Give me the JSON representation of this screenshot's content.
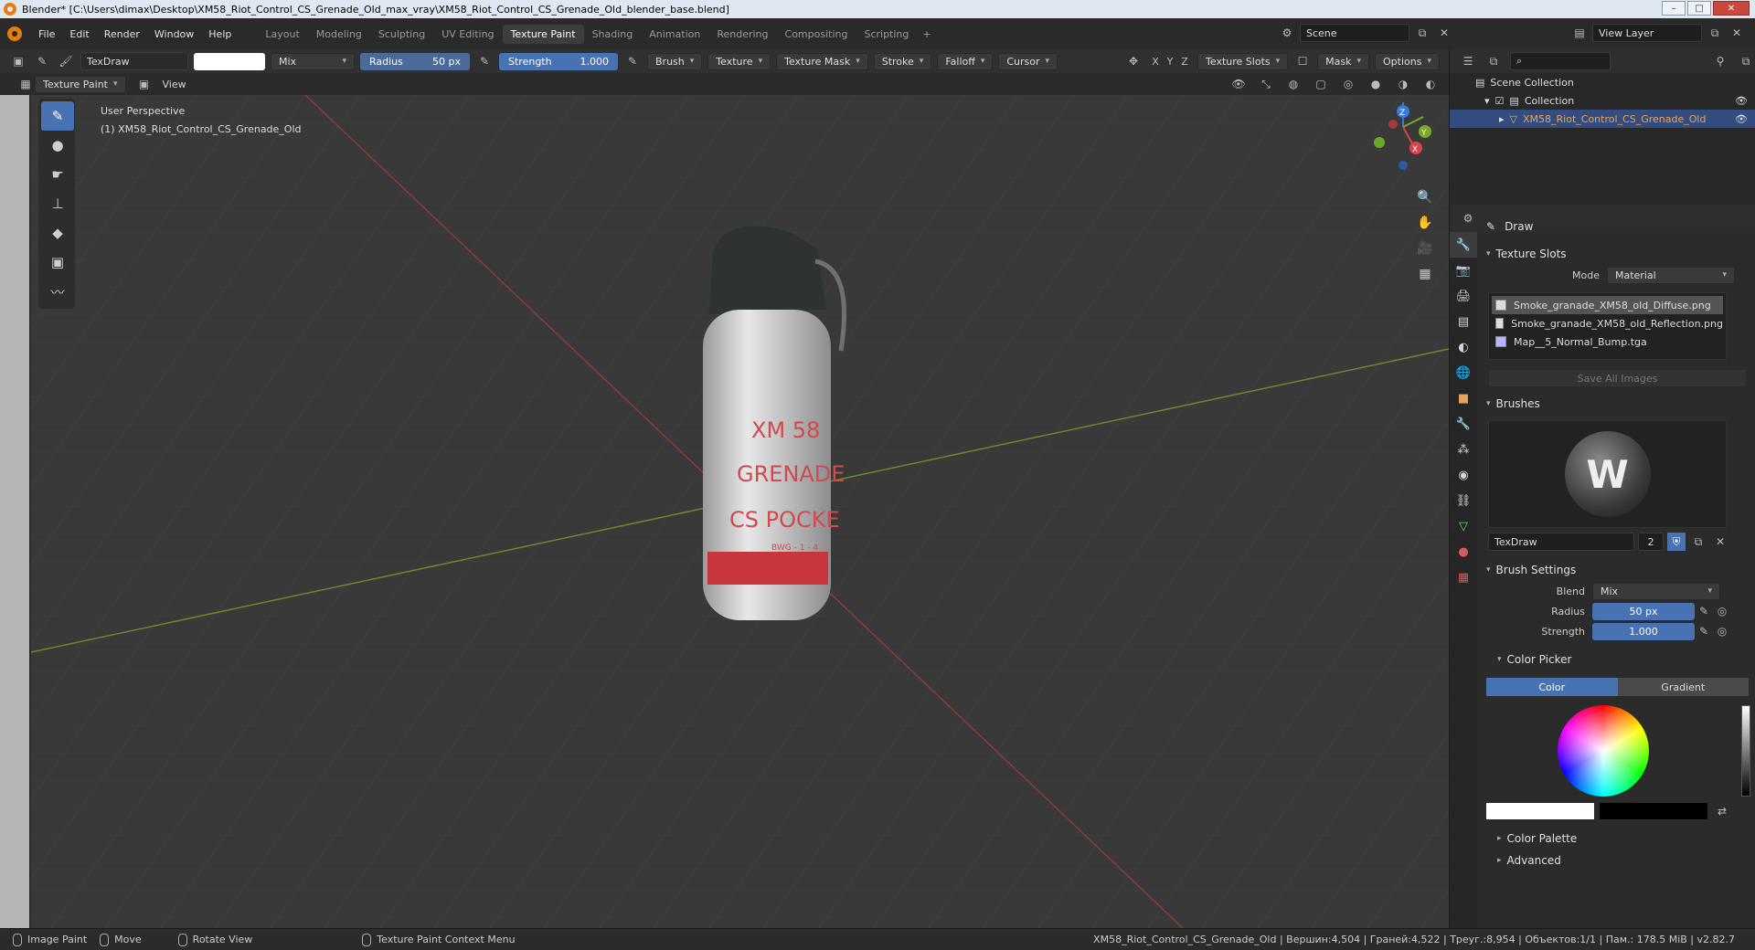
{
  "window": {
    "title": "Blender* [C:\\Users\\dimax\\Desktop\\XM58_Riot_Control_CS_Grenade_Old_max_vray\\XM58_Riot_Control_CS_Grenade_Old_blender_base.blend]"
  },
  "menu": [
    "File",
    "Edit",
    "Render",
    "Window",
    "Help"
  ],
  "workspaces": [
    "Layout",
    "Modeling",
    "Sculpting",
    "UV Editing",
    "Texture Paint",
    "Shading",
    "Animation",
    "Rendering",
    "Compositing",
    "Scripting"
  ],
  "active_workspace": "Texture Paint",
  "scene": {
    "name": "Scene",
    "view_layer": "View Layer"
  },
  "tool_header": {
    "brush_name": "TexDraw",
    "blend": "Mix",
    "radius_label": "Radius",
    "radius_value": "50 px",
    "strength_label": "Strength",
    "strength_value": "1.000",
    "menus": [
      "Brush",
      "Texture",
      "Texture Mask",
      "Stroke",
      "Falloff",
      "Cursor"
    ],
    "axes": [
      "X",
      "Y",
      "Z"
    ],
    "texture_slots": "Texture Slots",
    "mask": "Mask",
    "options": "Options"
  },
  "sub_header": {
    "mode": "Texture Paint",
    "view": "View"
  },
  "viewport": {
    "perspective": "User Perspective",
    "object": "(1) XM58_Riot_Control_CS_Grenade_Old",
    "label_line1": "XM 58",
    "label_line2": "GRENADE",
    "label_line3": "CS POCKE",
    "label_line4": "BWG - 1 - 4",
    "gizmo": {
      "x": "X",
      "y": "Y",
      "z": "Z"
    }
  },
  "outliner": {
    "scene_collection": "Scene Collection",
    "collection": "Collection",
    "object": "XM58_Riot_Control_CS_Grenade_Old"
  },
  "properties": {
    "tool_name": "Draw",
    "texture_slots_title": "Texture Slots",
    "mode_label": "Mode",
    "mode_value": "Material",
    "slots": [
      "Smoke_granade_XM58_old_Diffuse.png",
      "Smoke_granade_XM58_old_Reflection.png",
      "Map__5_Normal_Bump.tga"
    ],
    "save_all": "Save All Images",
    "brushes_title": "Brushes",
    "brush_name": "TexDraw",
    "brush_users": "2",
    "brush_settings_title": "Brush Settings",
    "blend_label": "Blend",
    "blend_value": "Mix",
    "radius_label": "Radius",
    "radius_value": "50 px",
    "strength_label": "Strength",
    "strength_value": "1.000",
    "color_picker_title": "Color Picker",
    "color_tab": "Color",
    "gradient_tab": "Gradient",
    "color_palette": "Color Palette",
    "advanced": "Advanced"
  },
  "statusbar": {
    "left1": "Image Paint",
    "left2": "Move",
    "left3": "Rotate View",
    "left4": "Texture Paint Context Menu",
    "right": "XM58_Riot_Control_CS_Grenade_Old | Вершин:4,504 | Граней:4,522 | Треуг.:8,954 | Объектов:1/1 | Пам.: 178.5 MiB | v2.82.7"
  },
  "colors": {
    "accent": "#4772b3",
    "selected_row": "#334d80",
    "grid_x": "#8a3a3a",
    "grid_y": "#6a8a2a"
  }
}
